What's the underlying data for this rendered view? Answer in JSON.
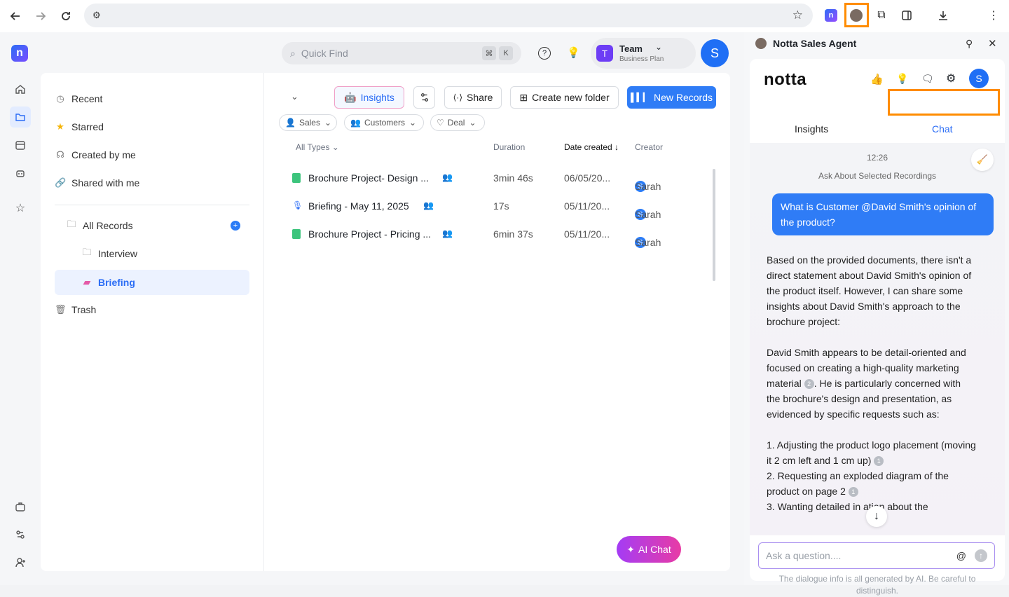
{
  "browser": {
    "url": "",
    "icons": [
      "back-icon",
      "forward-icon",
      "reload-icon",
      "site-settings-icon",
      "star-icon",
      "notta-extension-icon",
      "profile-extension-icon",
      "extensions-icon",
      "side-panel-icon",
      "download-icon",
      "menu-icon"
    ]
  },
  "topbar": {
    "search_placeholder": "Quick Find",
    "shortcut_cmd": "⌘",
    "shortcut_key": "K",
    "team_name": "Team",
    "team_plan": "Business Plan",
    "team_badge": "T",
    "avatar": "S"
  },
  "sidebar": {
    "items": [
      {
        "label": "Recent"
      },
      {
        "label": "Starred"
      },
      {
        "label": "Created by me"
      },
      {
        "label": "Shared with me"
      }
    ],
    "all_records": "All Records",
    "folders": [
      {
        "label": "Interview"
      },
      {
        "label": "Briefing"
      }
    ],
    "trash": "Trash"
  },
  "toolbar": {
    "insights": "Insights",
    "share": "Share",
    "new_folder": "Create new folder",
    "new_records": "New Records"
  },
  "filters": [
    "Sales",
    "Customers",
    "Deal"
  ],
  "table": {
    "headers": {
      "type": "All Types",
      "duration": "Duration",
      "date": "Date created",
      "creator": "Creator"
    },
    "rows": [
      {
        "name": "Brochure Project- Design ...",
        "duration": "3min 46s",
        "date": "06/05/20...",
        "creator": "Sarah",
        "creator_initial": "S"
      },
      {
        "name": "Briefing - May 11, 2025",
        "duration": "17s",
        "date": "05/11/20...",
        "creator": "Sarah",
        "creator_initial": "S"
      },
      {
        "name": "Brochure Project - Pricing ...",
        "duration": "6min 37s",
        "date": "05/11/20...",
        "creator": "Sarah",
        "creator_initial": "S"
      }
    ]
  },
  "ai_chat_button": "AI Chat",
  "side_panel": {
    "title": "Notta Sales Agent",
    "logo": "notta",
    "avatar": "S",
    "tabs": [
      "Insights",
      "Chat"
    ],
    "timestamp": "12:26",
    "context_label": "Ask About Selected Recordings",
    "user_message": "What is Customer @David Smith's opinion of the product?",
    "answer": {
      "p1": "Based on the provided documents, there isn't a direct statement about David Smith's opinion of the product itself. However, I can share some insights about David Smith's approach to the brochure project:",
      "p2a": "David Smith appears to be detail-oriented and focused on creating a high-quality marketing material",
      "p2_cite": "2",
      "p2b": ". He is particularly concerned with the brochure's design and presentation, as evidenced by specific requests such as:",
      "l1": "1. Adjusting the product logo placement (moving it 2 cm left and 1 cm up)",
      "l1_cite": "1",
      "l2": "2. Requesting an exploded diagram of the product on page 2",
      "l2_cite": "1",
      "l3": "3. Wanting detailed in    ation about the"
    },
    "input_placeholder": "Ask a question....",
    "at_symbol": "@",
    "disclaimer": "The dialogue info is all generated by AI. Be careful to distinguish."
  }
}
